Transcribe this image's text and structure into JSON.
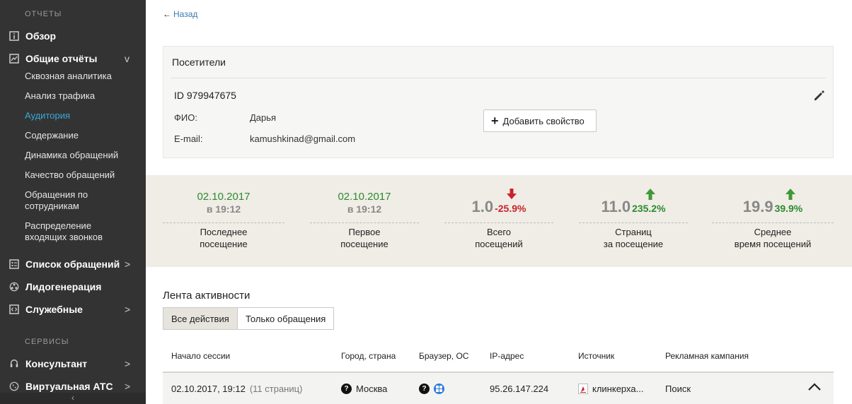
{
  "sidebar": {
    "section_reports": "ОТЧЕТЫ",
    "overview": "Обзор",
    "general_reports": "Общие отчёты",
    "general_chevron": "v",
    "sub_items": [
      "Сквозная аналитика",
      "Анализ трафика",
      "Аудитория",
      "Содержание",
      "Динамика обращений",
      "Качество обращений",
      "Обращения по сотрудникам",
      "Распределение входящих звонков"
    ],
    "active_item": "Аудитория",
    "requests_list": "Список обращений",
    "leadgen": "Лидогенерация",
    "service": "Служебные",
    "section_services": "СЕРВИСЫ",
    "consultant": "Консультант",
    "virtual_pbx": "Виртуальная АТС",
    "chevron": ">",
    "collapse": "‹"
  },
  "back_link": "Назад",
  "visitor": {
    "title": "Посетители",
    "id": "ID 979947675",
    "fio_label": "ФИО:",
    "fio_value": "Дарья",
    "email_label": "E-mail:",
    "email_value": "kamushkinad@gmail.com",
    "add_property": "Добавить свойство"
  },
  "stats": [
    {
      "date": "02.10.2017",
      "time": "в 19:12",
      "caption1": "Последнее",
      "caption2": "посещение"
    },
    {
      "date": "02.10.2017",
      "time": "в 19:12",
      "caption1": "Первое",
      "caption2": "посещение"
    },
    {
      "value": "1.0",
      "change": "-25.9%",
      "direction": "down",
      "caption1": "Всего",
      "caption2": "посещений"
    },
    {
      "value": "11.0",
      "change": "235.2%",
      "direction": "up",
      "caption1": "Страниц",
      "caption2": "за посещение"
    },
    {
      "value": "19.9",
      "change": "39.9%",
      "direction": "up",
      "caption1": "Среднее",
      "caption2": "время посещений"
    }
  ],
  "colors": {
    "up": "#2e8a2e",
    "down": "#c8232c",
    "accent": "#3aa8d8",
    "sidebar_bg": "#333333"
  },
  "feed": {
    "title": "Лента активности",
    "filter_all": "Все действия",
    "filter_requests": "Только обращения",
    "columns": [
      "Начало сессии",
      "Город, страна",
      "Браузер, ОС",
      "IP-адрес",
      "Источник",
      "Рекламная кампания"
    ],
    "rows": [
      {
        "session_start": "02.10.2017, 19:12",
        "pages": "(11 страниц)",
        "city": "Москва",
        "ip": "95.26.147.224",
        "source": "клинкерха...",
        "campaign": "Поиск"
      }
    ]
  }
}
